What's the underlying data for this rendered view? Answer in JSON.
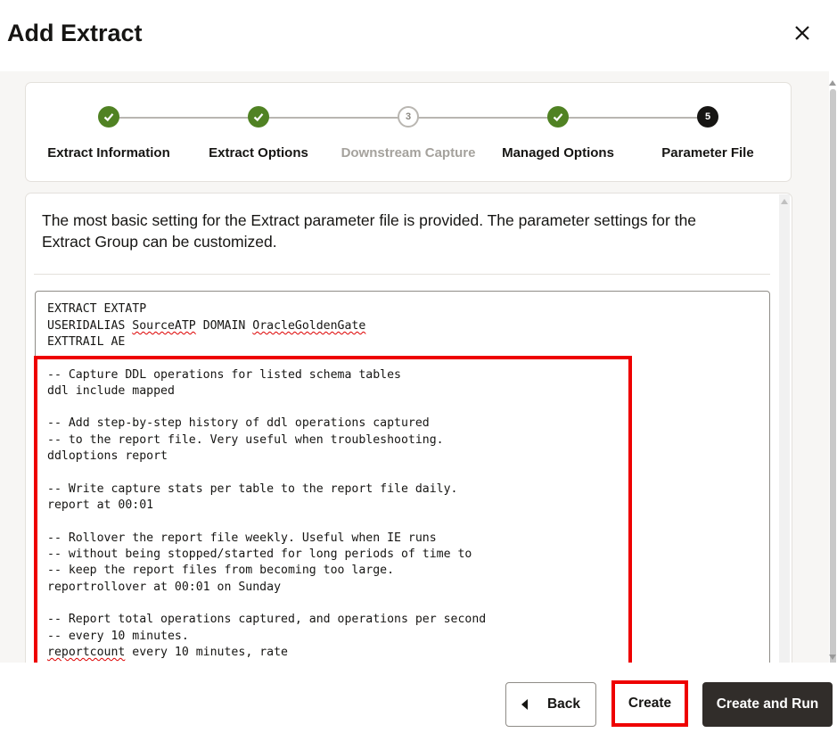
{
  "dialog": {
    "title": "Add Extract",
    "close_icon": "close-icon"
  },
  "train": {
    "steps": [
      {
        "label": "Extract Information",
        "status": "complete",
        "marker": ""
      },
      {
        "label": "Extract Options",
        "status": "complete",
        "marker": ""
      },
      {
        "label": "Downstream Capture",
        "status": "disabled",
        "marker": "3"
      },
      {
        "label": "Managed Options",
        "status": "complete",
        "marker": ""
      },
      {
        "label": "Parameter File",
        "status": "current",
        "marker": "5"
      }
    ]
  },
  "description": "The most basic setting for the Extract parameter file is provided. The parameter settings for the Extract Group can be customized.",
  "parameter_file": {
    "lines": [
      "EXTRACT EXTATP",
      "USERIDALIAS SourceATP DOMAIN OracleGoldenGate",
      "EXTTRAIL AE",
      "-- Capture DDL operations for listed schema tables",
      "ddl include mapped",
      "-- Add step-by-step history of ddl operations captured",
      "-- to the report file. Very useful when troubleshooting.",
      "ddloptions report",
      "-- Write capture stats per table to the report file daily.",
      "report at 00:01",
      "-- Rollover the report file weekly. Useful when IE runs",
      "-- without being stopped/started for long periods of time to",
      "-- keep the report files from becoming too large.",
      "reportrollover at 00:01 on Sunday",
      "-- Report total operations captured, and operations per second",
      "-- every 10 minutes.",
      "reportcount every 10 minutes, rate"
    ],
    "misspelled_words": [
      "SourceATP",
      "OracleGoldenGate",
      "reportcount"
    ]
  },
  "footer": {
    "back_label": "Back",
    "create_label": "Create",
    "create_run_label": "Create and Run"
  },
  "colors": {
    "complete": "#508223",
    "current": "#161513",
    "primary_button": "#312d2a",
    "highlight": "#ee0000"
  }
}
